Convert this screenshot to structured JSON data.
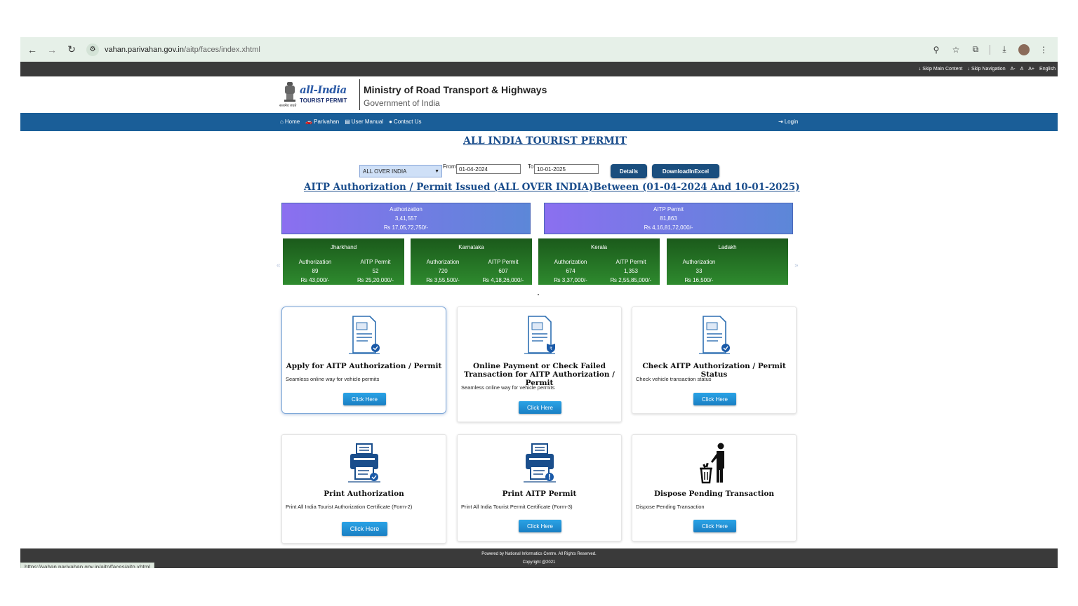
{
  "browser": {
    "url_host": "vahan.parivahan.gov.in",
    "url_path": "/aitp/faces/index.xhtml",
    "status_url": "https://vahan.parivahan.gov.in/aitp/faces/aitp.xhtml"
  },
  "topstrip": {
    "skip_main": "↓ Skip Main Content",
    "skip_nav": "↓ Skip Navigation",
    "font_small": "A-",
    "font_normal": "A",
    "font_large": "A+",
    "language": "English"
  },
  "header": {
    "logo_line1": "all-India",
    "logo_line2": "TOURIST PERMIT",
    "emblem_caption": "सत्यमेव जयते",
    "ministry": "Ministry of Road Transport & Highways",
    "government": "Government of India"
  },
  "nav": {
    "home": "Home",
    "parivahan": "Parivahan",
    "user_manual": "User Manual",
    "contact_us": "Contact Us",
    "login": "Login"
  },
  "main": {
    "title": "ALL INDIA TOURIST PERMIT",
    "region_select": "ALL OVER INDIA",
    "from_label": "From",
    "from_value": "01-04-2024",
    "to_label": "To",
    "to_value": "10-01-2025",
    "details_btn": "Details",
    "excel_btn": "DownloadInExcel",
    "subtitle": "AITP Authorization / Permit Issued (ALL OVER INDIA)Between (01-04-2024 And 10-01-2025)"
  },
  "summary": {
    "authorization": {
      "label": "Authorization",
      "count": "3,41,557",
      "amount": "₨ 17,05,72,750/-"
    },
    "permit": {
      "label": "AITP Permit",
      "count": "81,863",
      "amount": "₨ 4,16,81,72,000/-"
    }
  },
  "states": [
    {
      "name": "Jharkhand",
      "auth_label": "Authorization",
      "auth_count": "89",
      "auth_amount": "₨ 43,000/-",
      "permit_label": "AITP Permit",
      "permit_count": "52",
      "permit_amount": "₨ 25,20,000/-"
    },
    {
      "name": "Karnataka",
      "auth_label": "Authorization",
      "auth_count": "720",
      "auth_amount": "₨ 3,55,500/-",
      "permit_label": "AITP Permit",
      "permit_count": "607",
      "permit_amount": "₨ 4,18,26,000/-"
    },
    {
      "name": "Kerala",
      "auth_label": "Authorization",
      "auth_count": "674",
      "auth_amount": "₨ 3,37,000/-",
      "permit_label": "AITP Permit",
      "permit_count": "1,353",
      "permit_amount": "₨ 2,55,85,000/-"
    },
    {
      "name": "Ladakh",
      "auth_label": "Authorization",
      "auth_count": "33",
      "auth_amount": "₨ 16,500/-",
      "permit_label": "",
      "permit_count": "",
      "permit_amount": ""
    }
  ],
  "cards": [
    {
      "title": "Apply for AITP Authorization / Permit",
      "desc": "Seamless online way for vehicle permits",
      "btn": "Click Here"
    },
    {
      "title": "Online Payment or Check Failed Transaction for AITP Authorization / Permit",
      "desc": "Seamless online way for vehicle permits",
      "btn": "Click Here"
    },
    {
      "title": "Check AITP Authorization / Permit Status",
      "desc": "Check vehicle transaction status",
      "btn": "Click Here"
    },
    {
      "title": "Print Authorization",
      "desc": "Print All India Tourist Authorization Certificate (Form-2)",
      "btn": "Click Here"
    },
    {
      "title": "Print AITP Permit",
      "desc": "Print All India Tourist Permit Certificate (Form-3)",
      "btn": "Click Here"
    },
    {
      "title": "Dispose Pending Transaction",
      "desc": "Dispose Pending Transaction",
      "btn": "Click Here"
    }
  ],
  "footer": {
    "powered": "Powered by National Informatics Centre. All Rights Reserved.",
    "copyright": "Copyright @2021"
  },
  "colors": {
    "navbar": "#1a5e98",
    "title_blue": "#1a4d8c",
    "state_green": "#2e8a2e",
    "button_blue": "#1a7fc3"
  }
}
